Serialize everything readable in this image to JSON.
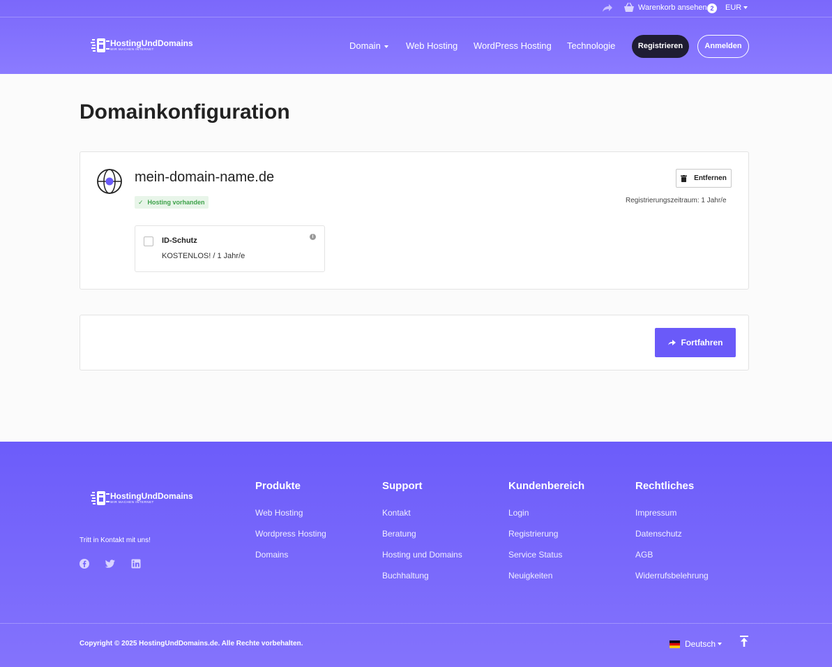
{
  "topbar": {
    "cart_label": "Warenkorb ansehen",
    "cart_count": "2",
    "currency": "EUR"
  },
  "brand": {
    "name": "HostingUndDomains",
    "tagline": "WIR MACHEN INTERNET"
  },
  "nav": {
    "domain": "Domain",
    "web_hosting": "Web Hosting",
    "wordpress_hosting": "WordPress Hosting",
    "technology": "Technologie",
    "register": "Registrieren",
    "login": "Anmelden"
  },
  "main": {
    "title": "Domainkonfiguration",
    "domain_name": "mein-domain-name.de",
    "hosting_badge": "Hosting vorhanden",
    "remove_label": "Entfernen",
    "registration_period": "Registrierungszeitraum: 1 Jahr/e",
    "addon": {
      "title": "ID-Schutz",
      "price": "KOSTENLOS! / 1 Jahr/e",
      "checked": false
    },
    "continue_label": "Fortfahren"
  },
  "footer": {
    "contact_text": "Tritt in Kontakt mit uns!",
    "columns": [
      {
        "title": "Produkte",
        "links": [
          "Web Hosting",
          "Wordpress Hosting",
          "Domains"
        ]
      },
      {
        "title": "Support",
        "links": [
          "Kontakt",
          "Beratung",
          "Hosting und Domains",
          "Buchhaltung"
        ]
      },
      {
        "title": "Kundenbereich",
        "links": [
          "Login",
          "Registrierung",
          "Service Status",
          "Neuigkeiten"
        ]
      },
      {
        "title": "Rechtliches",
        "links": [
          "Impressum",
          "Datenschutz",
          "AGB",
          "Widerrufsbelehrung"
        ]
      }
    ],
    "social": [
      "facebook-icon",
      "twitter-icon",
      "linkedin-icon"
    ],
    "copyright": "Copyright © 2025 HostingUndDomains.de. Alle Rechte vorbehalten.",
    "language": "Deutsch"
  },
  "colors": {
    "primary": "#6a5af9",
    "header_bg": "#7b68fb",
    "dark_button": "#1f1d33",
    "success": "#3ea24a"
  }
}
